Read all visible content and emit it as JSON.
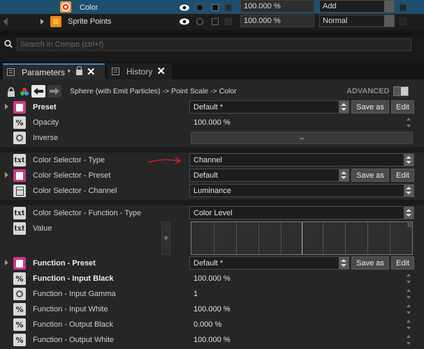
{
  "layers": [
    {
      "name": "Color",
      "opacity": "100.000 %",
      "blend": "Add",
      "icon": "color-wheel-icon",
      "selected": true
    },
    {
      "name": "Sprite Points",
      "opacity": "100.000 %",
      "blend": "Normal",
      "icon": "sprite-points-icon",
      "selected": false
    }
  ],
  "search": {
    "placeholder": "Search in Compo (ctrl+f)"
  },
  "tabs": [
    {
      "label": "Parameters *",
      "active": true
    },
    {
      "label": "History",
      "active": false
    }
  ],
  "breadcrumb": {
    "path": "Sphere (with Emit Particles) -> Point Scale -> Color",
    "advanced_label": "ADVANCED"
  },
  "params": {
    "preset1": {
      "label": "Preset",
      "value": "Default *",
      "save": "Save as",
      "edit": "Edit"
    },
    "opacity": {
      "label": "Opacity",
      "value": "100.000 %"
    },
    "inverse": {
      "label": "Inverse"
    },
    "cs_type": {
      "label": "Color Selector - Type",
      "value": "Channel"
    },
    "cs_preset": {
      "label": "Color Selector - Preset",
      "value": "Default",
      "save": "Save as",
      "edit": "Edit"
    },
    "cs_channel": {
      "label": "Color Selector - Channel",
      "value": "Luminance"
    },
    "csf_type": {
      "label": "Color Selector - Function - Type",
      "value": "Color Level"
    },
    "value": {
      "label": "Value",
      "curve_end": "1("
    },
    "fn_preset": {
      "label": "Function - Preset",
      "value": "Default *",
      "save": "Save as",
      "edit": "Edit"
    },
    "fn_in_black": {
      "label": "Function - Input Black",
      "value": "100.000 %"
    },
    "fn_in_gamma": {
      "label": "Function - Input Gamma",
      "value": "1"
    },
    "fn_in_white": {
      "label": "Function - Input White",
      "value": "100.000 %"
    },
    "fn_out_black": {
      "label": "Function - Output Black",
      "value": "0.000 %"
    },
    "fn_out_white": {
      "label": "Function - Output White",
      "value": "100.000 %"
    }
  },
  "colors": {
    "accent": "#2e8bcd",
    "preset_icon": "#cc3a8a",
    "annotation_arrow": "#cc2222",
    "selected_row": "#1e4f6e"
  }
}
